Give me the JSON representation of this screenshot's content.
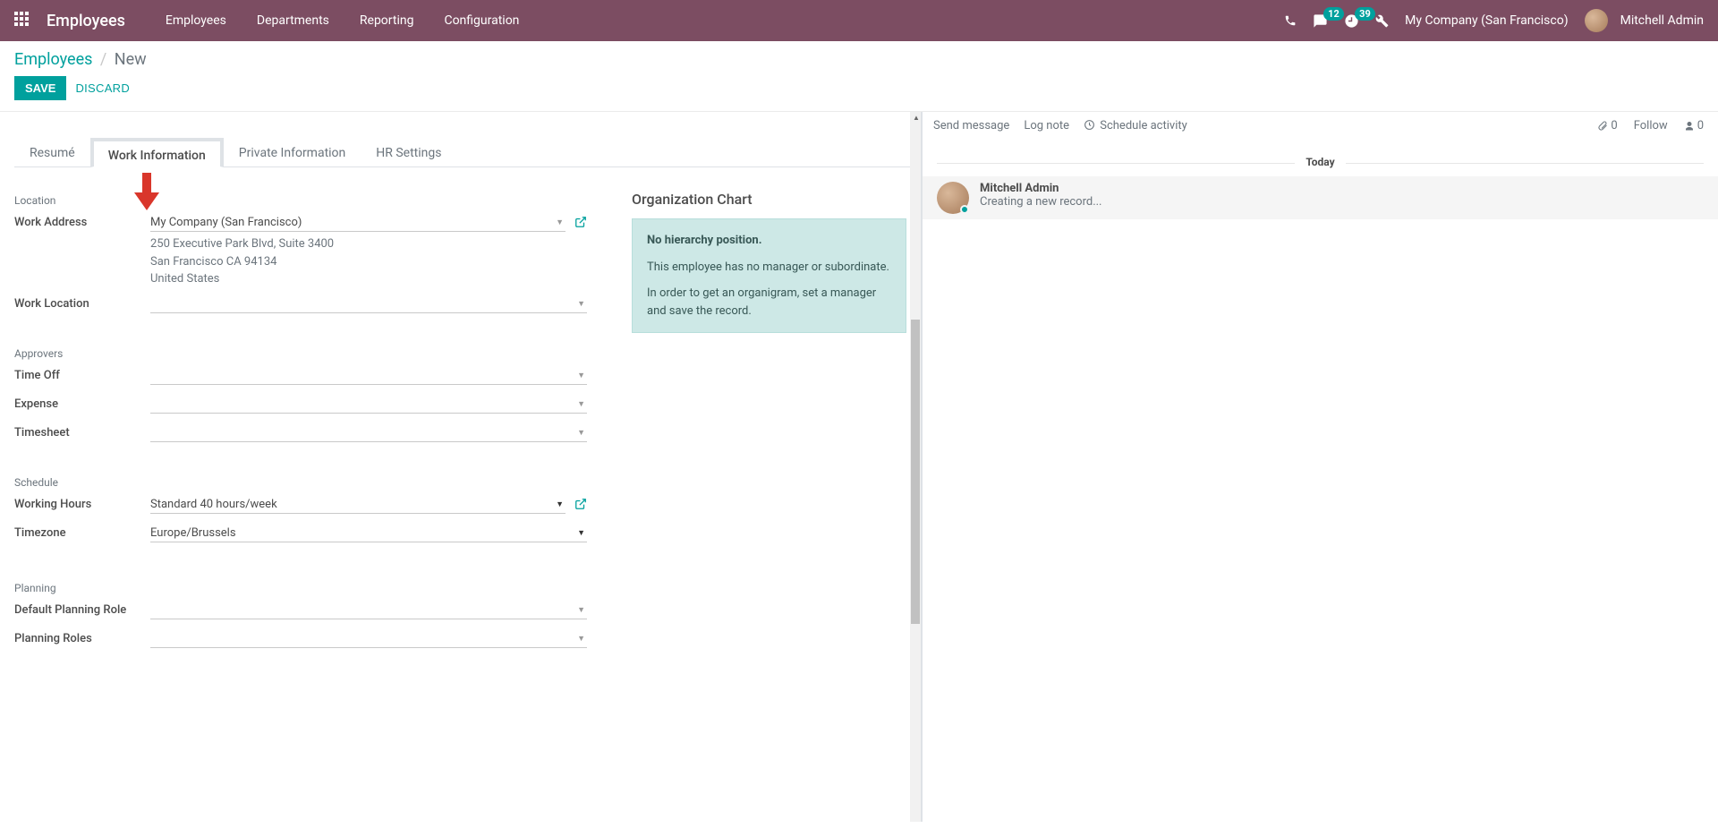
{
  "navbar": {
    "brand": "Employees",
    "links": [
      "Employees",
      "Departments",
      "Reporting",
      "Configuration"
    ],
    "msg_count": "12",
    "activity_count": "39",
    "company": "My Company (San Francisco)",
    "user": "Mitchell Admin"
  },
  "breadcrumb": {
    "root": "Employees",
    "current": "New"
  },
  "buttons": {
    "save": "SAVE",
    "discard": "DISCARD"
  },
  "tabs": {
    "resume": "Resumé",
    "work_info": "Work Information",
    "private_info": "Private Information",
    "hr_settings": "HR Settings"
  },
  "sections": {
    "location": "Location",
    "approvers": "Approvers",
    "schedule": "Schedule",
    "planning": "Planning"
  },
  "fields": {
    "work_address_label": "Work Address",
    "work_address_value": "My Company (San Francisco)",
    "work_address_line1": "250 Executive Park Blvd, Suite 3400",
    "work_address_line2": "San Francisco CA 94134",
    "work_address_line3": "United States",
    "work_location_label": "Work Location",
    "work_location_value": "",
    "time_off_label": "Time Off",
    "time_off_value": "",
    "expense_label": "Expense",
    "expense_value": "",
    "timesheet_label": "Timesheet",
    "timesheet_value": "",
    "working_hours_label": "Working Hours",
    "working_hours_value": "Standard 40 hours/week",
    "timezone_label": "Timezone",
    "timezone_value": "Europe/Brussels",
    "default_role_label": "Default Planning Role",
    "default_role_value": "",
    "planning_roles_label": "Planning Roles",
    "planning_roles_value": ""
  },
  "org_chart": {
    "title": "Organization Chart",
    "alert_title": "No hierarchy position.",
    "alert_p1": "This employee has no manager or subordinate.",
    "alert_p2": "In order to get an organigram, set a manager and save the record."
  },
  "chatter": {
    "send": "Send message",
    "log": "Log note",
    "schedule": "Schedule activity",
    "attach_count": "0",
    "follow": "Follow",
    "follower_count": "0",
    "today": "Today",
    "msg_author": "Mitchell Admin",
    "msg_text": "Creating a new record..."
  }
}
